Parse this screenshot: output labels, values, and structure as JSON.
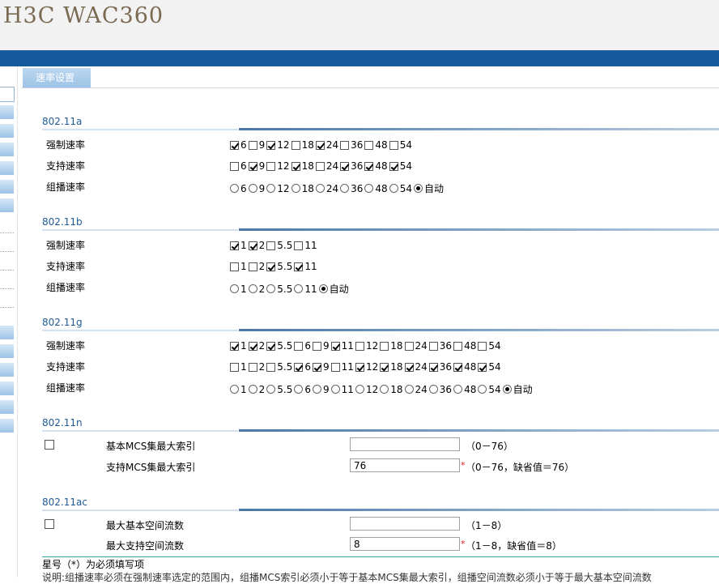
{
  "app": {
    "title": "H3C WAC360"
  },
  "tabs": [
    {
      "label": "速率设置"
    }
  ],
  "sections": {
    "a": {
      "title": "802.11a",
      "mandatory": {
        "label": "强制速率",
        "options": [
          {
            "v": "6",
            "on": true
          },
          {
            "v": "9",
            "on": false
          },
          {
            "v": "12",
            "on": true
          },
          {
            "v": "18",
            "on": false
          },
          {
            "v": "24",
            "on": true
          },
          {
            "v": "36",
            "on": false
          },
          {
            "v": "48",
            "on": false
          },
          {
            "v": "54",
            "on": false
          }
        ]
      },
      "supported": {
        "label": "支持速率",
        "options": [
          {
            "v": "6",
            "on": false
          },
          {
            "v": "9",
            "on": true
          },
          {
            "v": "12",
            "on": false
          },
          {
            "v": "18",
            "on": true
          },
          {
            "v": "24",
            "on": false
          },
          {
            "v": "36",
            "on": true
          },
          {
            "v": "48",
            "on": true
          },
          {
            "v": "54",
            "on": true
          }
        ]
      },
      "multicast": {
        "label": "组播速率",
        "options": [
          {
            "v": "6",
            "on": false
          },
          {
            "v": "9",
            "on": false
          },
          {
            "v": "12",
            "on": false
          },
          {
            "v": "18",
            "on": false
          },
          {
            "v": "24",
            "on": false
          },
          {
            "v": "36",
            "on": false
          },
          {
            "v": "48",
            "on": false
          },
          {
            "v": "54",
            "on": false
          },
          {
            "v": "自动",
            "on": true
          }
        ]
      }
    },
    "b": {
      "title": "802.11b",
      "mandatory": {
        "label": "强制速率",
        "options": [
          {
            "v": "1",
            "on": true
          },
          {
            "v": "2",
            "on": true
          },
          {
            "v": "5.5",
            "on": false
          },
          {
            "v": "11",
            "on": false
          }
        ]
      },
      "supported": {
        "label": "支持速率",
        "options": [
          {
            "v": "1",
            "on": false
          },
          {
            "v": "2",
            "on": false
          },
          {
            "v": "5.5",
            "on": true
          },
          {
            "v": "11",
            "on": true
          }
        ]
      },
      "multicast": {
        "label": "组播速率",
        "options": [
          {
            "v": "1",
            "on": false
          },
          {
            "v": "2",
            "on": false
          },
          {
            "v": "5.5",
            "on": false
          },
          {
            "v": "11",
            "on": false
          },
          {
            "v": "自动",
            "on": true
          }
        ]
      }
    },
    "g": {
      "title": "802.11g",
      "mandatory": {
        "label": "强制速率",
        "options": [
          {
            "v": "1",
            "on": true
          },
          {
            "v": "2",
            "on": true
          },
          {
            "v": "5.5",
            "on": true
          },
          {
            "v": "6",
            "on": false
          },
          {
            "v": "9",
            "on": false
          },
          {
            "v": "11",
            "on": true
          },
          {
            "v": "12",
            "on": false
          },
          {
            "v": "18",
            "on": false
          },
          {
            "v": "24",
            "on": false
          },
          {
            "v": "36",
            "on": false
          },
          {
            "v": "48",
            "on": false
          },
          {
            "v": "54",
            "on": false
          }
        ]
      },
      "supported": {
        "label": "支持速率",
        "options": [
          {
            "v": "1",
            "on": false
          },
          {
            "v": "2",
            "on": false
          },
          {
            "v": "5.5",
            "on": false
          },
          {
            "v": "6",
            "on": true
          },
          {
            "v": "9",
            "on": true
          },
          {
            "v": "11",
            "on": false
          },
          {
            "v": "12",
            "on": true
          },
          {
            "v": "18",
            "on": true
          },
          {
            "v": "24",
            "on": true
          },
          {
            "v": "36",
            "on": true
          },
          {
            "v": "48",
            "on": true
          },
          {
            "v": "54",
            "on": true
          }
        ]
      },
      "multicast": {
        "label": "组播速率",
        "options": [
          {
            "v": "1",
            "on": false
          },
          {
            "v": "2",
            "on": false
          },
          {
            "v": "5.5",
            "on": false
          },
          {
            "v": "6",
            "on": false
          },
          {
            "v": "9",
            "on": false
          },
          {
            "v": "11",
            "on": false
          },
          {
            "v": "12",
            "on": false
          },
          {
            "v": "18",
            "on": false
          },
          {
            "v": "24",
            "on": false
          },
          {
            "v": "36",
            "on": false
          },
          {
            "v": "48",
            "on": false
          },
          {
            "v": "54",
            "on": false
          },
          {
            "v": "自动",
            "on": true
          }
        ]
      }
    },
    "n": {
      "title": "802.11n",
      "basic_mcs": {
        "label": "基本MCS集最大索引",
        "value": "",
        "hint": "（0－76）"
      },
      "support_mcs": {
        "label": "支持MCS集最大索引",
        "value": "76",
        "star": "*",
        "hint": "（0－76，缺省值＝76）"
      }
    },
    "ac": {
      "title": "802.11ac",
      "basic_ss": {
        "label": "最大基本空间流数",
        "value": "",
        "hint": "（1－8）"
      },
      "support_ss": {
        "label": "最大支持空间流数",
        "value": "8",
        "star": "*",
        "hint": "（1－8，缺省值＝8）"
      }
    }
  },
  "footer": {
    "note": "星号（*）为必须填写项",
    "desc": "说明:组播速率必须在强制速率选定的范围内，组播MCS索引必须小于等于基本MCS集最大索引，组播空间流数必须小于等于最大基本空间流数"
  },
  "colors": {
    "topbar": "#155a9c",
    "section_title": "#1f5a96",
    "required_star": "#e02020"
  }
}
